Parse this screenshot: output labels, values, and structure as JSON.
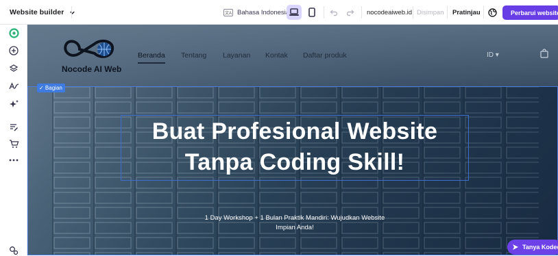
{
  "topbar": {
    "title": "Website builder",
    "language": "Bahasa Indonesia",
    "language_icon_text": "文A",
    "domain": "nocodeaiweb.id",
    "saved": "Disimpan",
    "preview": "Pratinjau",
    "publish": "Perbarui website"
  },
  "site": {
    "logo_text": "Nocode AI Web",
    "nav": [
      "Beranda",
      "Tentang",
      "Layanan",
      "Kontak",
      "Daftar produk"
    ],
    "lang_select": "ID ▾",
    "section_tag": "✓ Bagian",
    "hero_title_line1": "Buat Profesional Website",
    "hero_title_line2": "Tanpa Coding Skill!",
    "hero_sub_line1": "1 Day Workshop + 1 Bulan Praktik Mandiri: Wujudkan Website",
    "hero_sub_line2": "Impian Anda!"
  },
  "chat": {
    "label": "Tanya Kodee"
  },
  "colors": {
    "accent": "#673de6",
    "outline": "#3f7be0"
  }
}
